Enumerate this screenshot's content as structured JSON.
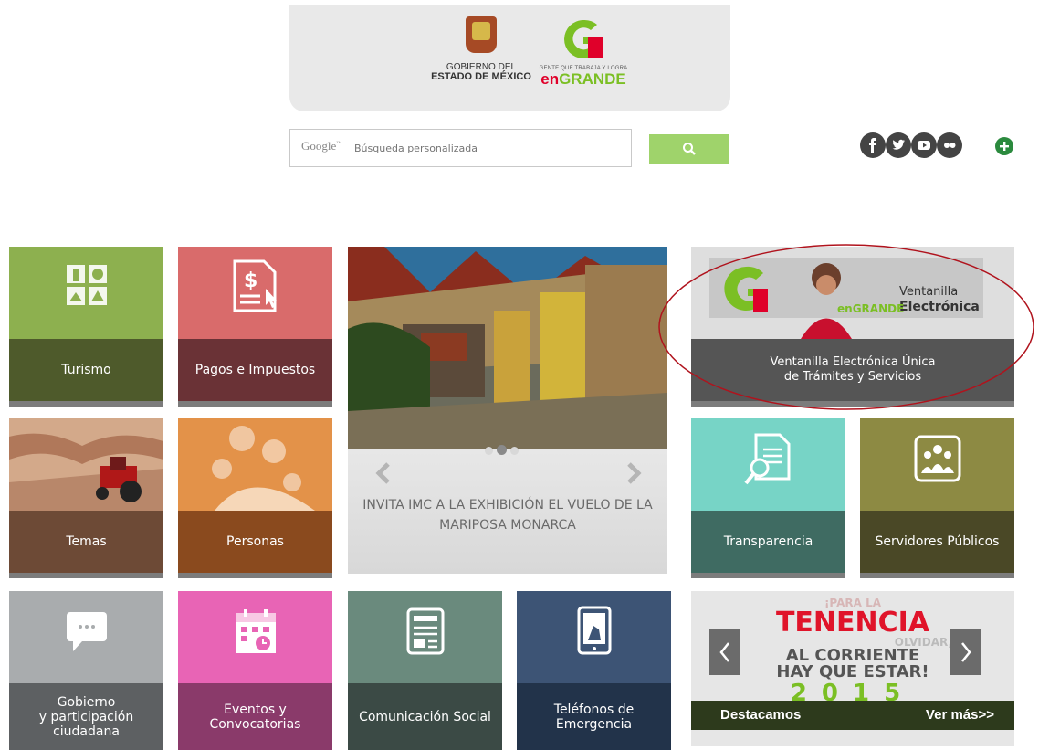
{
  "header": {
    "gov_line1": "GOBIERNO DEL",
    "gov_line2": "ESTADO DE MÉXICO",
    "brand_tagline": "GENTE QUE TRABAJA Y LOGRA",
    "brand_word_en": "en",
    "brand_word_grande": "GRANDE"
  },
  "search": {
    "brand": "Google",
    "brand_tm": "™",
    "placeholder": "Búsqueda personalizada",
    "button_icon": "search-icon"
  },
  "social": [
    "facebook-icon",
    "twitter-icon",
    "youtube-icon",
    "flickr-icon",
    "plus-icon"
  ],
  "tiles": {
    "turismo": "Turismo",
    "pagos": "Pagos e Impuestos",
    "temas": "Temas",
    "personas": "Personas",
    "transparencia": "Transparencia",
    "servidores": "Servidores Públicos",
    "gobierno": [
      "Gobierno",
      "y participación",
      "ciudadana"
    ],
    "eventos": [
      "Eventos y",
      "Convocatorias"
    ],
    "comunicacion": "Comunicación Social",
    "telefonos": [
      "Teléfonos de",
      "Emergencia"
    ]
  },
  "ventanilla": {
    "sign_line1": "Ventanilla",
    "sign_line2": "Electrónica",
    "sign_brand_en": "en",
    "sign_brand_grande": "GRANDE",
    "caption_line1": "Ventanilla Electrónica Única",
    "caption_line2": "de Trámites y Servicios"
  },
  "carousel": {
    "caption_line1": "INVITA IMC A LA EXHIBICIÓN EL VUELO DE LA",
    "caption_line2": "MARIPOSA MONARCA",
    "dots": 3,
    "active_dot": 2
  },
  "promo": {
    "line1": "¡PARA LA",
    "line2": "TENENCIA",
    "line3": "OLVIDAR,",
    "line4": "AL CORRIENTE",
    "line5": "HAY QUE ESTAR!",
    "year": "2015",
    "footer_left": "Destacamos",
    "footer_right": "Ver más>>"
  },
  "colors": {
    "green_tile": "#8db04f",
    "green_bar": "#4e5a2b",
    "pink_tile": "#d96b6b",
    "maroon_bar": "#6a3236",
    "teal_tile": "#77d4c6",
    "teal_bar": "#3f6b62",
    "olive_tile": "#8d8a43",
    "olive_bar": "#4a4826",
    "highlight_ring": "#b0131d"
  }
}
